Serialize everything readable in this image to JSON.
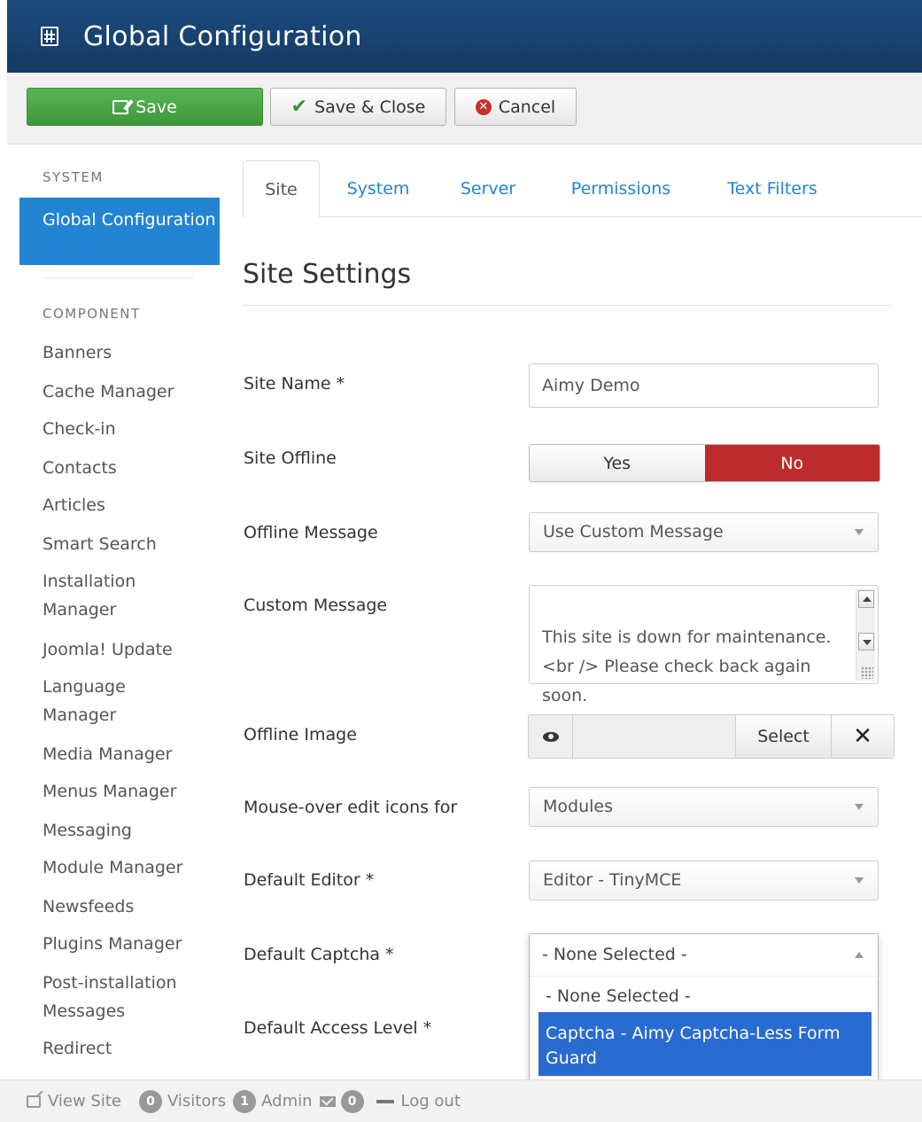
{
  "header": {
    "title": "Global Configuration",
    "icon": "sliders-icon"
  },
  "toolbar": {
    "save_label": "Save",
    "save_close_label": "Save & Close",
    "cancel_label": "Cancel"
  },
  "sidebar": {
    "system_heading": "SYSTEM",
    "active_item": "Global Configuration",
    "component_heading": "COMPONENT",
    "items": [
      "Banners",
      "Cache Manager",
      "Check-in",
      "Contacts",
      "Articles",
      "Smart Search",
      "Installation Manager",
      "Joomla! Update",
      "Language Manager",
      "Media Manager",
      "Menus Manager",
      "Messaging",
      "Module Manager",
      "Newsfeeds",
      "Plugins Manager",
      "Post-installation Messages",
      "Redirect"
    ]
  },
  "tabs": [
    "Site",
    "System",
    "Server",
    "Permissions",
    "Text Filters"
  ],
  "section_title": "Site Settings",
  "fields": {
    "site_name": {
      "label": "Site Name *",
      "value": "Aimy Demo"
    },
    "site_offline": {
      "label": "Site Offline",
      "yes": "Yes",
      "no": "No"
    },
    "offline_message": {
      "label": "Offline Message",
      "value": "Use Custom Message"
    },
    "custom_message": {
      "label": "Custom Message",
      "value": "This site is down for maintenance.<br /> Please check back again soon."
    },
    "offline_image": {
      "label": "Offline Image",
      "select_label": "Select",
      "clear_label": "✕"
    },
    "mouseover": {
      "label": "Mouse-over edit icons for",
      "value": "Modules"
    },
    "default_editor": {
      "label": "Default Editor *",
      "value": "Editor - TinyMCE"
    },
    "default_captcha": {
      "label": "Default Captcha *",
      "value": "- None Selected -",
      "options": [
        "- None Selected -",
        "Captcha - Aimy Captcha-Less Form Guard"
      ]
    },
    "default_access": {
      "label": "Default Access Level *"
    }
  },
  "statusbar": {
    "view_site": "View Site",
    "visitors_count": "0",
    "visitors_label": "Visitors",
    "admin_count": "1",
    "admin_label": "Admin",
    "messages_count": "0",
    "logout_label": "Log out"
  },
  "colors": {
    "header": "#173f6a",
    "save_green": "#46a546",
    "active_blue": "#2384d3",
    "toggle_no_red": "#bd2c2c",
    "dropdown_highlight": "#2a6bd1"
  }
}
